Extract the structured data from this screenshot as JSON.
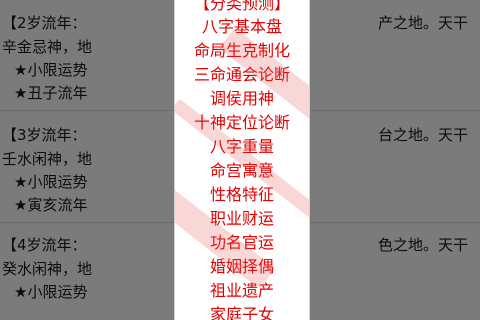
{
  "background": {
    "blocks": [
      {
        "lines": [
          "【2岁流年：",
          "辛金忌神，地",
          "★小限运势",
          "★丑子流年"
        ],
        "right_text": "产之地。天干"
      },
      {
        "lines": [
          "【3岁流年：",
          "壬水闲神，地",
          "★小限运势",
          "★寅亥流年"
        ],
        "right_text": "台之地。天干"
      },
      {
        "lines": [
          "【4岁流年：",
          "癸水闲神，地",
          "★小限运势"
        ],
        "right_text": "色之地。天干"
      }
    ]
  },
  "menu": {
    "title": "【分类预测】",
    "items": [
      "八字基本盘",
      "命局生克制化",
      "三命通会论断",
      "调侯用神",
      "十神定位论断",
      "八字重量",
      "命宫寓意",
      "性格特征",
      "职业财运",
      "功名官运",
      "婚姻择偶",
      "祖业遗产",
      "家庭子女"
    ],
    "text_color": "#e40000"
  }
}
